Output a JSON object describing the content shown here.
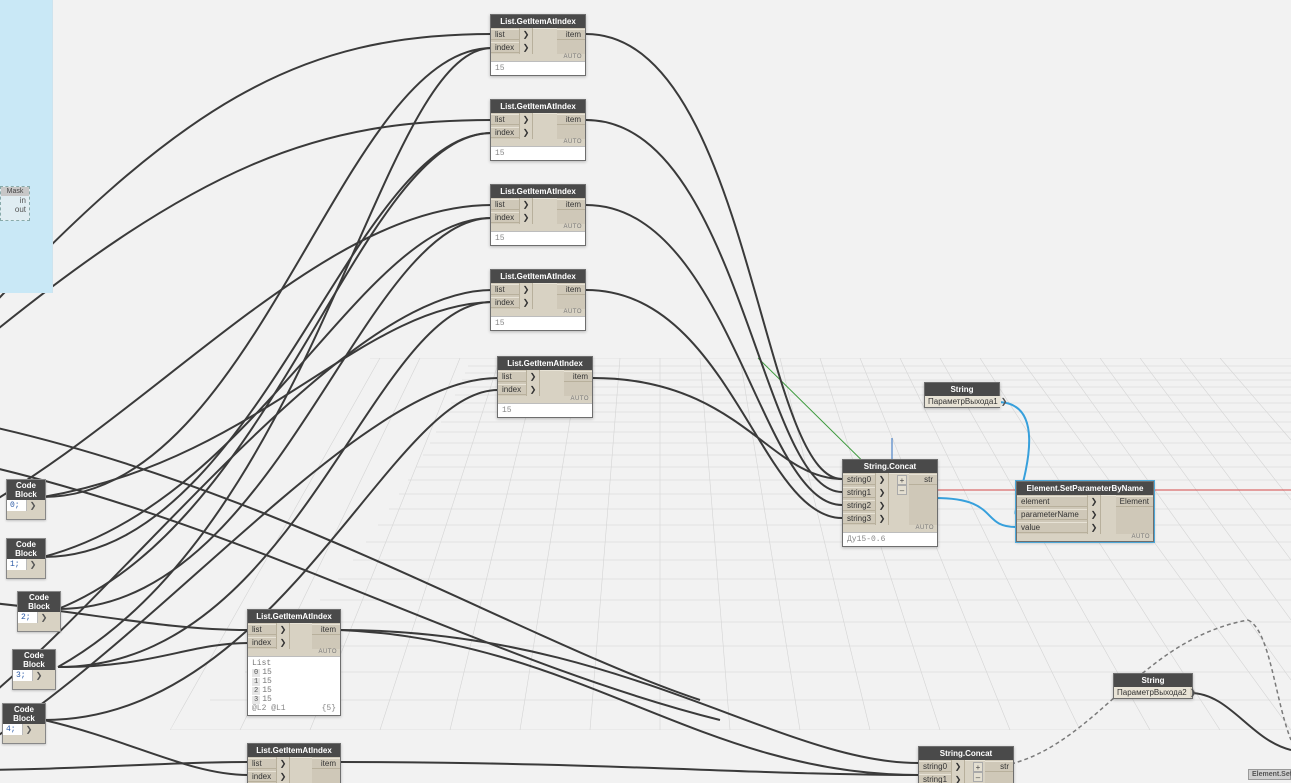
{
  "app": {
    "name": "Dynamo",
    "view": "Graph Canvas"
  },
  "panel": {
    "present": true
  },
  "maskNode": {
    "title": "Mask",
    "ports": [
      "in",
      "out"
    ]
  },
  "getItemAtIndex": {
    "title": "List.GetItemAtIndex",
    "in": {
      "list": "list",
      "index": "index"
    },
    "out": "item",
    "lacing": "AUTO",
    "preview_single": "15",
    "preview_list": {
      "header": "List",
      "rows": [
        {
          "idx": "0",
          "val": "15"
        },
        {
          "idx": "1",
          "val": "15"
        },
        {
          "idx": "2",
          "val": "15"
        },
        {
          "idx": "3",
          "val": "15"
        }
      ],
      "footer_left": "@L2 @L1",
      "footer_right": "{5}"
    }
  },
  "codeBlock": {
    "title": "Code Block",
    "values": [
      "0;",
      "1;",
      "2;",
      "3;",
      "4;"
    ]
  },
  "stringNode": {
    "title": "String",
    "value1": "ПараметрВыхода1",
    "value2": "ПараметрВыхода2"
  },
  "concat": {
    "title": "String.Concat",
    "inputs": [
      "string0",
      "string1",
      "string2",
      "string3"
    ],
    "inputs2": [
      "string0",
      "string1"
    ],
    "out": "str",
    "lacing": "AUTO",
    "preview": "Ду15-0.6",
    "plus": "+",
    "minus": "–"
  },
  "setParam": {
    "title": "Element.SetParameterByName",
    "inputs": [
      "element",
      "parameterName",
      "value"
    ],
    "out": "Element",
    "lacing": "AUTO"
  },
  "ghost": {
    "title": "Element.Set"
  },
  "chev": "❯"
}
